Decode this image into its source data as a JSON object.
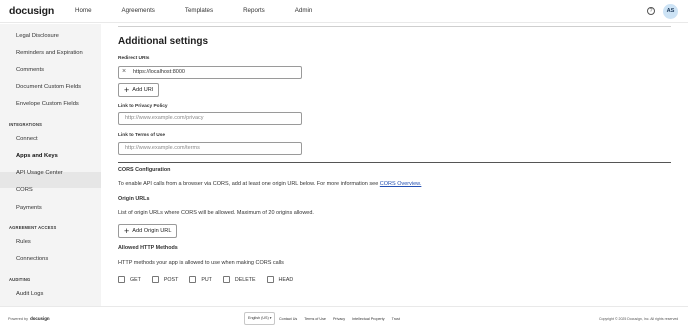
{
  "brand": {
    "name": "docusign"
  },
  "nav": {
    "items": [
      "Home",
      "Agreements",
      "Templates",
      "Reports",
      "Admin"
    ]
  },
  "header": {
    "help_icon": "?",
    "avatar_initials": "AS"
  },
  "sidebar": {
    "top_items": [
      "Legal Disclosure",
      "Reminders and Expiration",
      "Comments",
      "Document Custom Fields",
      "Envelope Custom Fields"
    ],
    "integrations_heading": "INTEGRATIONS",
    "integrations_items": [
      "Connect",
      "Apps and Keys",
      "API Usage Center",
      "CORS",
      "Payments"
    ],
    "agreement_access_heading": "AGREEMENT ACCESS",
    "agreement_access_items": [
      "Rules",
      "Connections"
    ],
    "auditing_heading": "AUDITING",
    "auditing_items": [
      "Audit Logs"
    ],
    "active_item": "Apps and Keys"
  },
  "main": {
    "title": "Additional settings",
    "redirect_label": "Redirect URIs",
    "redirect_value": "https://localhost:8000",
    "add_uri_label": "Add URI",
    "privacy_label": "Link to Privacy Policy",
    "privacy_placeholder": "http://www.example.com/privacy",
    "terms_label": "Link to Terms of Use",
    "terms_placeholder": "http://www.example.com/terms",
    "cors_heading": "CORS Configuration",
    "cors_text": "To enable API calls from a browser via CORS, add at least one origin URL below. For more information see",
    "cors_link": "CORS Overview.",
    "origin_heading": "Origin URLs",
    "origin_text": "List of origin URLs where CORS will be allowed. Maximum of 20 origins allowed.",
    "add_origin_label": "Add Origin URL",
    "methods_heading": "Allowed HTTP Methods",
    "methods_text": "HTTP methods your app is allowed to use when making CORS calls",
    "methods": [
      "GET",
      "POST",
      "PUT",
      "DELETE",
      "HEAD"
    ]
  },
  "footer": {
    "powered_by": "Powered by",
    "powered_logo": "docusign",
    "language": "English (US)",
    "links": [
      "Contact Us",
      "Terms of Use",
      "Privacy",
      "Intellectual Property",
      "Trust"
    ],
    "copyright": "Copyright © 2025 Docusign, Inc. All rights reserved"
  }
}
